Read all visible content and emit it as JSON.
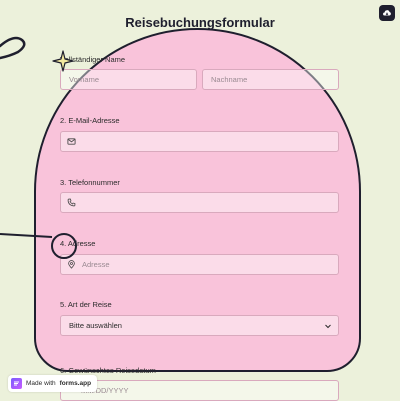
{
  "form": {
    "title": "Reisebuchungsformular",
    "fields": [
      {
        "label": "Vollständiger Name",
        "inputs": [
          {
            "placeholder": "Vorname"
          },
          {
            "placeholder": "Nachname"
          }
        ]
      },
      {
        "label": "2. E-Mail-Adresse",
        "icon": "mail-icon",
        "placeholder": ""
      },
      {
        "label": "3. Telefonnummer",
        "icon": "phone-icon",
        "placeholder": ""
      },
      {
        "label": "4. Adresse",
        "icon": "location-pin-icon",
        "placeholder": "Adresse"
      },
      {
        "label": "5. Art der Reise",
        "selected": "Bitte auswählen",
        "icon": "chevron-down-icon"
      },
      {
        "label": "6. Gewünschtes Reisedatum",
        "placeholder": "MM/DD/YYYY"
      }
    ]
  },
  "header": {
    "corner_icon": "cloud-save-icon"
  },
  "badge": {
    "prefix": "Made with",
    "brand": "forms.app",
    "icon": "forms-app-logo-icon"
  },
  "colors": {
    "background": "#ecf1db",
    "arch": "#f9c3da",
    "outline": "#1f1f2e",
    "star": "#f3e9a0"
  }
}
